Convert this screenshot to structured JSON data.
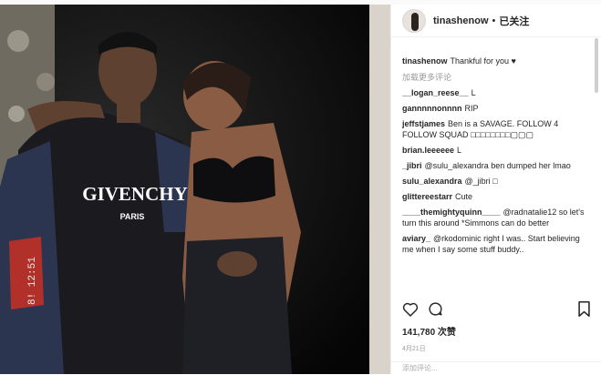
{
  "header": {
    "username": "tinashenow",
    "separator": "•",
    "follow_status": "已关注"
  },
  "caption": {
    "user": "tinashenow",
    "text": "Thankful for you ♥"
  },
  "load_more": "加载更多评论",
  "comments": [
    {
      "user": "__logan_reese__",
      "text": "L"
    },
    {
      "user": "gannnnnonnnn",
      "text": "RIP"
    },
    {
      "user": "jeffstjames",
      "text": "Ben is a SAVAGE. FOLLOW 4 FOLLOW SQUAD □□□□□□□□▢▢▢"
    },
    {
      "user": "brian.leeeeee",
      "text": "L"
    },
    {
      "user": "_jibri",
      "text": "@sulu_alexandra ben dumped her lmao"
    },
    {
      "user": "sulu_alexandra",
      "text": "@_jibri □"
    },
    {
      "user": "glittereestarr",
      "text": "Cute"
    },
    {
      "user": "____themightyquinn____",
      "text": "@radnatalie12 so let's turn this around *Simmons can do better"
    },
    {
      "user": "aviary_",
      "text": "@rkodominic right I was.. Start believing me when I say some stuff buddy.."
    }
  ],
  "likes": "141,780 次赞",
  "date": "4月21日",
  "add_comment_placeholder": "添加评论...",
  "photo": {
    "shirt_text": "GIVENCHY",
    "shirt_sub": "PARIS"
  },
  "icons": {
    "like": "heart-icon",
    "comment": "comment-icon",
    "save": "bookmark-icon"
  },
  "colors": {
    "text": "#262626",
    "muted": "#999999",
    "border": "#efefef"
  }
}
